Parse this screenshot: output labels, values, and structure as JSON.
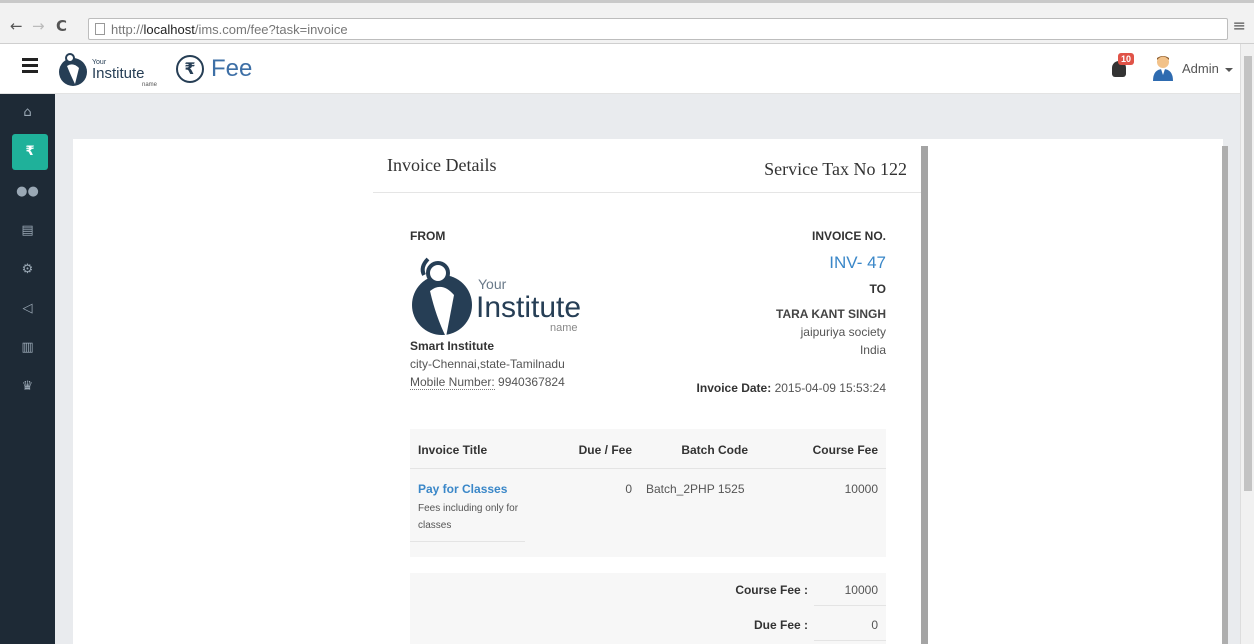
{
  "browser": {
    "url_prefix": "http://",
    "url_host": "localhost",
    "url_path": "/ims.com/fee?task=invoice"
  },
  "header": {
    "logo_small_word": "Your",
    "logo_big_word": "Institute",
    "logo_tag": "name",
    "fee_symbol": "₹",
    "page_title": "Fee",
    "notification_count": "10",
    "user_name": "Admin"
  },
  "sidebar": {
    "items": [
      {
        "name": "home-icon",
        "glyph": "⌂"
      },
      {
        "name": "rupee-icon",
        "glyph": "₹"
      },
      {
        "name": "users-icon",
        "glyph": "👥"
      },
      {
        "name": "document-icon",
        "glyph": "▤"
      },
      {
        "name": "gears-icon",
        "glyph": "⚙"
      },
      {
        "name": "megaphone-icon",
        "glyph": "📢"
      },
      {
        "name": "bar-chart-icon",
        "glyph": "▥"
      },
      {
        "name": "trophy-icon",
        "glyph": "🏆"
      }
    ]
  },
  "invoice": {
    "heading": "Invoice Details",
    "service_tax": "Service Tax No 122",
    "from_label": "FROM",
    "logo_small_word": "Your",
    "logo_big_word": "Institute",
    "logo_tag": "name",
    "institute_name": "Smart Institute",
    "institute_address": "city-Chennai,state-Tamilnadu",
    "mobile_label": "Mobile Number:",
    "mobile_value": " 9940367824",
    "invoice_no_label": "INVOICE NO.",
    "invoice_no": "INV- 47",
    "to_label": "TO",
    "customer_name": "TARA KANT SINGH",
    "customer_addr1": "jaipuriya society",
    "customer_addr2": "India",
    "date_label": "Invoice Date:",
    "date_value": " 2015-04-09 15:53:24",
    "table": {
      "headers": [
        "Invoice Title",
        "Due / Fee",
        "Batch Code",
        "Course Fee"
      ],
      "row": {
        "title": "Pay for Classes",
        "description": "Fees including only for classes",
        "due": "0",
        "batch": "Batch_2PHP 1525",
        "course_fee": "10000"
      }
    },
    "totals": {
      "course_fee_label": "Course Fee :",
      "course_fee_value": "10000",
      "due_fee_label": "Due Fee :",
      "due_fee_value": "0"
    }
  },
  "colors": {
    "accent": "#1fb19a",
    "link": "#3a87c8",
    "sidebar_bg": "#1e2a36",
    "badge": "#e05348"
  }
}
